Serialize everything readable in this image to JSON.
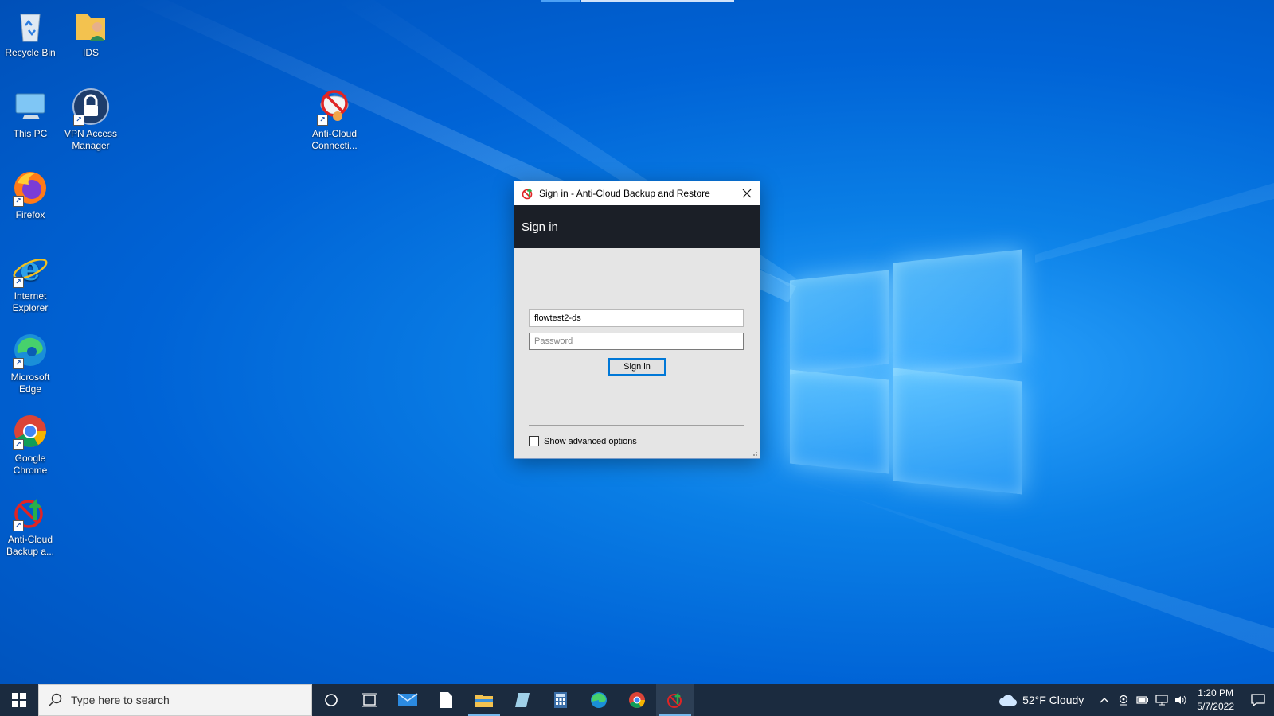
{
  "desktop": {
    "icons": [
      {
        "label": "Recycle Bin"
      },
      {
        "label": "IDS"
      },
      {
        "label": "This PC"
      },
      {
        "label": "VPN Access Manager"
      },
      {
        "label": "Anti-Cloud Connecti..."
      },
      {
        "label": "Firefox"
      },
      {
        "label": "Internet Explorer"
      },
      {
        "label": "Microsoft Edge"
      },
      {
        "label": "Google Chrome"
      },
      {
        "label": "Anti-Cloud Backup a..."
      }
    ]
  },
  "dialog": {
    "title": "Sign in - Anti-Cloud Backup and Restore",
    "header": "Sign in",
    "username_value": "flowtest2-ds",
    "password_placeholder": "Password",
    "signin_label": "Sign in",
    "advanced_label": "Show advanced options"
  },
  "taskbar": {
    "search_placeholder": "Type here to search",
    "weather": "52°F  Cloudy",
    "time": "1:20 PM",
    "date": "5/7/2022"
  },
  "colors": {
    "accent": "#0078d7",
    "taskbar": "#1b2b3f",
    "dialog_header": "#1b1f27"
  }
}
